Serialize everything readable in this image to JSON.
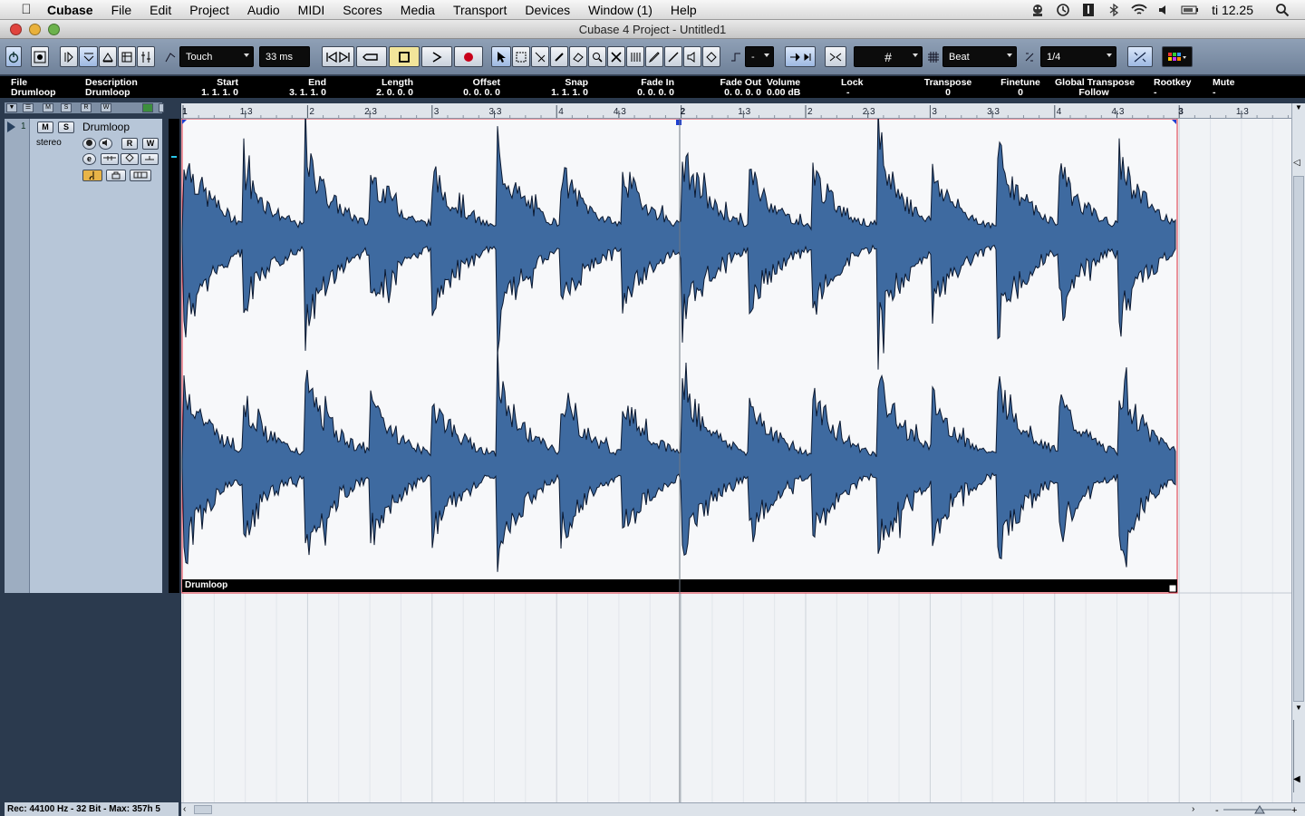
{
  "menubar": {
    "app": "Cubase",
    "items": [
      "File",
      "Edit",
      "Project",
      "Audio",
      "MIDI",
      "Scores",
      "Media",
      "Transport",
      "Devices",
      "Window (1)",
      "Help"
    ],
    "clock": "ti 12.25"
  },
  "window": {
    "title": "Cubase 4 Project - Untitled1"
  },
  "toolbar": {
    "automation_mode": "Touch",
    "latency": "33 ms",
    "quantize_type": "Beat",
    "quantize_value": "1/4"
  },
  "info_line": {
    "file": {
      "label": "File",
      "value": "Drumloop"
    },
    "description": {
      "label": "Description",
      "value": "Drumloop"
    },
    "start": {
      "label": "Start",
      "value": "1. 1. 1.   0"
    },
    "end": {
      "label": "End",
      "value": "3. 1. 1.   0"
    },
    "length": {
      "label": "Length",
      "value": "2. 0. 0.   0"
    },
    "offset": {
      "label": "Offset",
      "value": "0. 0. 0.   0"
    },
    "snap": {
      "label": "Snap",
      "value": "1. 1. 1.   0"
    },
    "fade_in": {
      "label": "Fade In",
      "value": "0. 0. 0.   0"
    },
    "fade_out": {
      "label": "Fade Out",
      "value": "0. 0. 0.   0"
    },
    "volume": {
      "label": "Volume",
      "value": "0.00 dB"
    },
    "lock": {
      "label": "Lock",
      "value": "-"
    },
    "transpose": {
      "label": "Transpose",
      "value": "0"
    },
    "finetune": {
      "label": "Finetune",
      "value": "0"
    },
    "global_transpose": {
      "label": "Global Transpose",
      "value": "Follow"
    },
    "rootkey": {
      "label": "Rootkey",
      "value": "-"
    },
    "mute": {
      "label": "Mute",
      "value": "-"
    }
  },
  "track": {
    "number": "1",
    "name": "Drumloop",
    "channel": "stereo",
    "mute_label": "M",
    "solo_label": "S",
    "read_label": "R",
    "write_label": "W",
    "edit_label": "e"
  },
  "ruler": {
    "labels": [
      "1",
      "1.3",
      "2",
      "2.3",
      "3",
      "3.3",
      "4",
      "4.3",
      "2",
      "1.3",
      "2",
      "2.3",
      "3",
      "3.3",
      "4",
      "4.3",
      "3",
      "1.3"
    ]
  },
  "event": {
    "name": "Drumloop"
  },
  "status": {
    "text": "Rec: 44100 Hz - 32 Bit - Max: 357h 5"
  },
  "colors": {
    "waveform": "#3e6aa0",
    "waveform_stroke": "#0a1830",
    "event_border": "#e03040",
    "background": "#2b3a4e"
  }
}
